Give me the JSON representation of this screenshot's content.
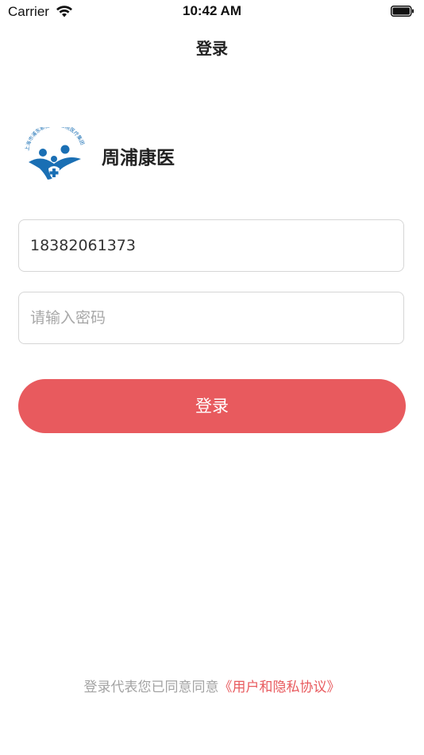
{
  "status_bar": {
    "carrier": "Carrier",
    "time": "10:42 AM"
  },
  "nav": {
    "title": "登录"
  },
  "brand": {
    "name": "周浦康医",
    "logo_text": "上海市浦东新区周浦医院医疗集团",
    "logo_color": "#1a6fb4"
  },
  "form": {
    "phone_value": "18382061373",
    "password_placeholder": "请输入密码"
  },
  "login_button": {
    "label": "登录",
    "color": "#e85a5e"
  },
  "agreement": {
    "prefix": "登录代表您已同意同意",
    "link": "《用户和隐私协议》",
    "link_color": "#e85a5e"
  },
  "icons": {
    "wifi": "wifi-icon",
    "battery": "battery-icon",
    "logo": "hospital-logo-icon"
  }
}
